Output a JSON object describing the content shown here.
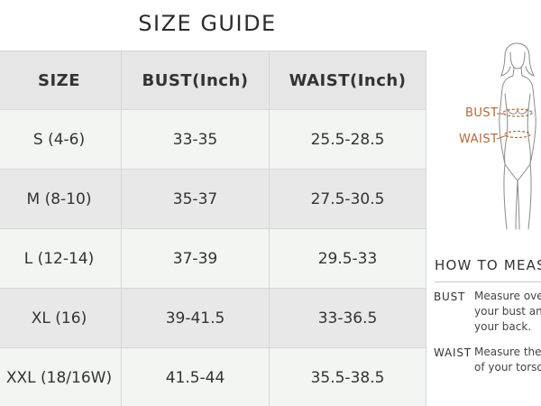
{
  "title": "SIZE GUIDE",
  "table": {
    "headers": [
      "SIZE",
      "BUST(Inch)",
      "WAIST(Inch)"
    ],
    "rows": [
      [
        "S (4-6)",
        "33-35",
        "25.5-28.5"
      ],
      [
        "M (8-10)",
        "35-37",
        "27.5-30.5"
      ],
      [
        "L (12-14)",
        "37-39",
        "29.5-33"
      ],
      [
        "XL (16)",
        "39-41.5",
        "33-36.5"
      ],
      [
        "XXL (18/16W)",
        "41.5-44",
        "35.5-38.5"
      ]
    ]
  },
  "figure": {
    "bust_label": "BUST",
    "waist_label": "WAIST",
    "accent_color": "#b06a3b"
  },
  "how_to": {
    "title": "HOW TO MEAS",
    "items": [
      {
        "term": "BUST",
        "lines": [
          "Measure over",
          "your bust and",
          "your back."
        ]
      },
      {
        "term": "WAIST",
        "lines": [
          "Measure the",
          "of your torso"
        ]
      }
    ]
  }
}
